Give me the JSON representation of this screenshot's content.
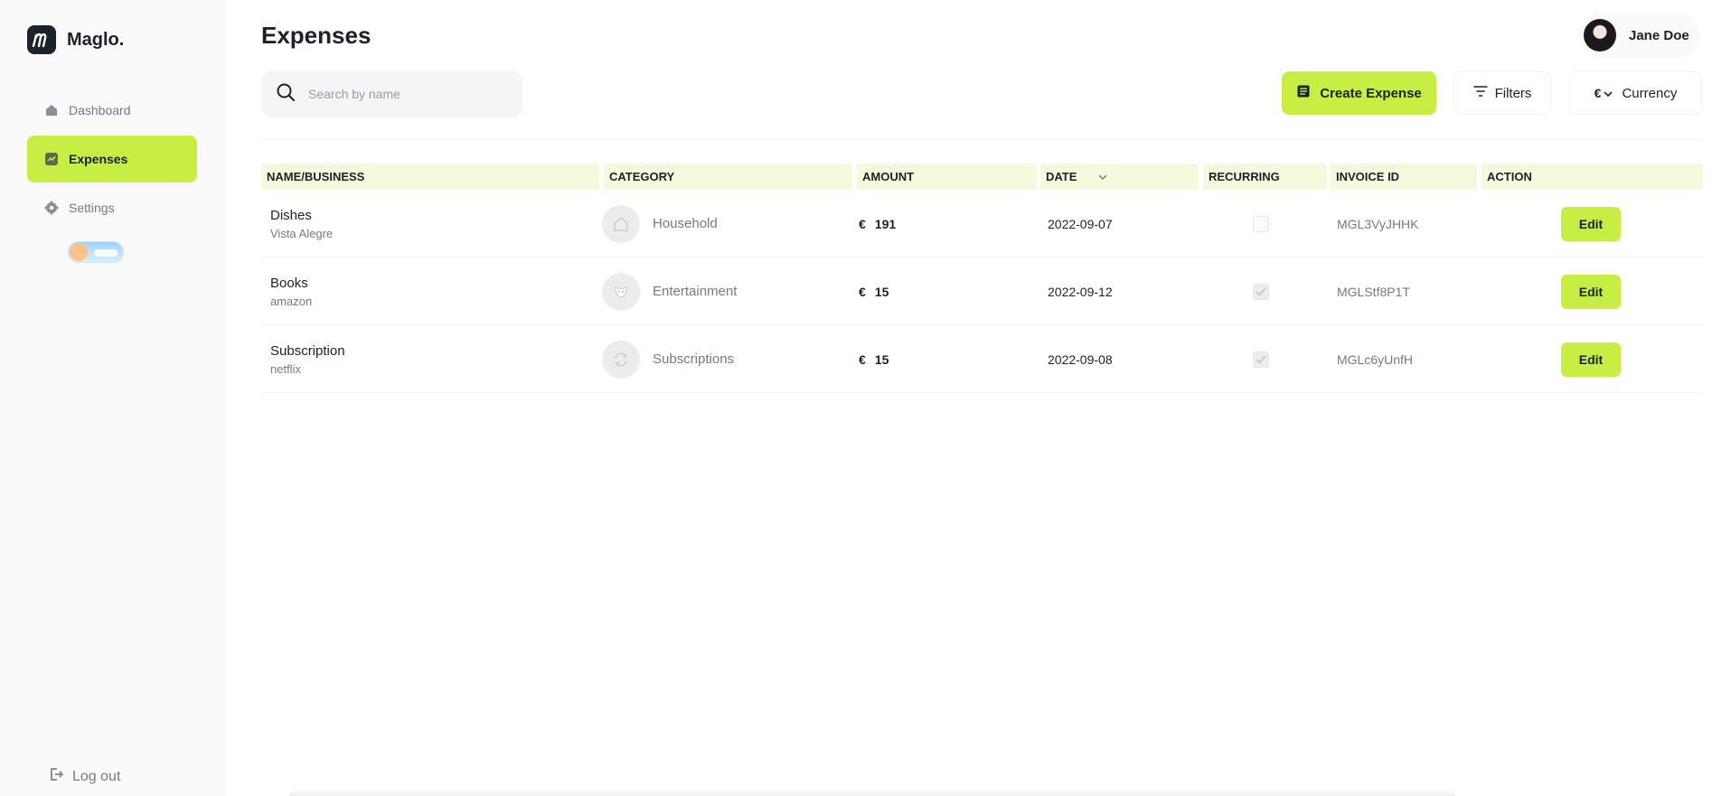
{
  "app": {
    "name": "Maglo."
  },
  "sidebar": {
    "items": [
      {
        "label": "Dashboard",
        "icon": "home-icon",
        "active": false
      },
      {
        "label": "Expenses",
        "icon": "chart-icon",
        "active": true
      },
      {
        "label": "Settings",
        "icon": "gear-icon",
        "active": false
      }
    ],
    "theme_toggle": {
      "state": "light"
    },
    "logout_label": "Log out"
  },
  "header": {
    "title": "Expenses",
    "user_name": "Jane Doe"
  },
  "toolbar": {
    "search_placeholder": "Search by name",
    "search_value": "",
    "create_label": "Create Expense",
    "filters_label": "Filters",
    "currency_symbol": "€",
    "currency_label": "Currency"
  },
  "table": {
    "columns": [
      "NAME/BUSINESS",
      "CATEGORY",
      "AMOUNT",
      "DATE",
      "RECURRING",
      "INVOICE ID",
      "ACTION"
    ],
    "rows": [
      {
        "name": "Dishes",
        "business": "Vista Alegre",
        "category": "Household",
        "currency": "€",
        "amount": "191",
        "date": "2022-09-07",
        "recurring": false,
        "invoice_id": "MGL3VyJHHK",
        "action": "Edit"
      },
      {
        "name": "Books",
        "business": "amazon",
        "category": "Entertainment",
        "currency": "€",
        "amount": "15",
        "date": "2022-09-12",
        "recurring": true,
        "invoice_id": "MGLStf8P1T",
        "action": "Edit"
      },
      {
        "name": "Subscription",
        "business": "netflix",
        "category": "Subscriptions",
        "currency": "€",
        "amount": "15",
        "date": "2022-09-08",
        "recurring": true,
        "invoice_id": "MGLc6yUnfH",
        "action": "Edit"
      }
    ]
  },
  "colors": {
    "accent": "#c8ee44",
    "header_bg": "#f4fbdc",
    "text_dark": "#1b212d",
    "text_muted": "#78778b"
  }
}
